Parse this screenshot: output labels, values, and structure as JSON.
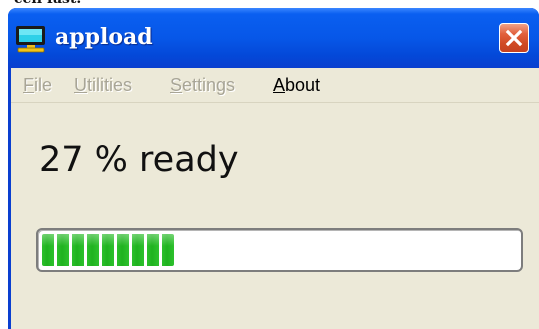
{
  "window": {
    "title": "appload",
    "icon": "monitor-icon",
    "close_icon": "close-icon"
  },
  "menu": {
    "items": [
      {
        "label": "File",
        "mnemonic": "F",
        "rest": "ile",
        "enabled": false
      },
      {
        "label": "Utilities",
        "mnemonic": "U",
        "rest": "tilities",
        "enabled": false
      },
      {
        "label": "Settings",
        "mnemonic": "S",
        "rest": "ettings",
        "enabled": false
      },
      {
        "label": "About",
        "mnemonic": "A",
        "rest": "bout",
        "enabled": true
      }
    ]
  },
  "status": {
    "text": "27 % ready"
  },
  "progress": {
    "value_fraction": 0.27
  },
  "colors": {
    "titlebar": "#0757e8",
    "client_bg": "#ece9d8",
    "progress_green": "#2cc02c",
    "close_button": "#d04a24"
  }
}
